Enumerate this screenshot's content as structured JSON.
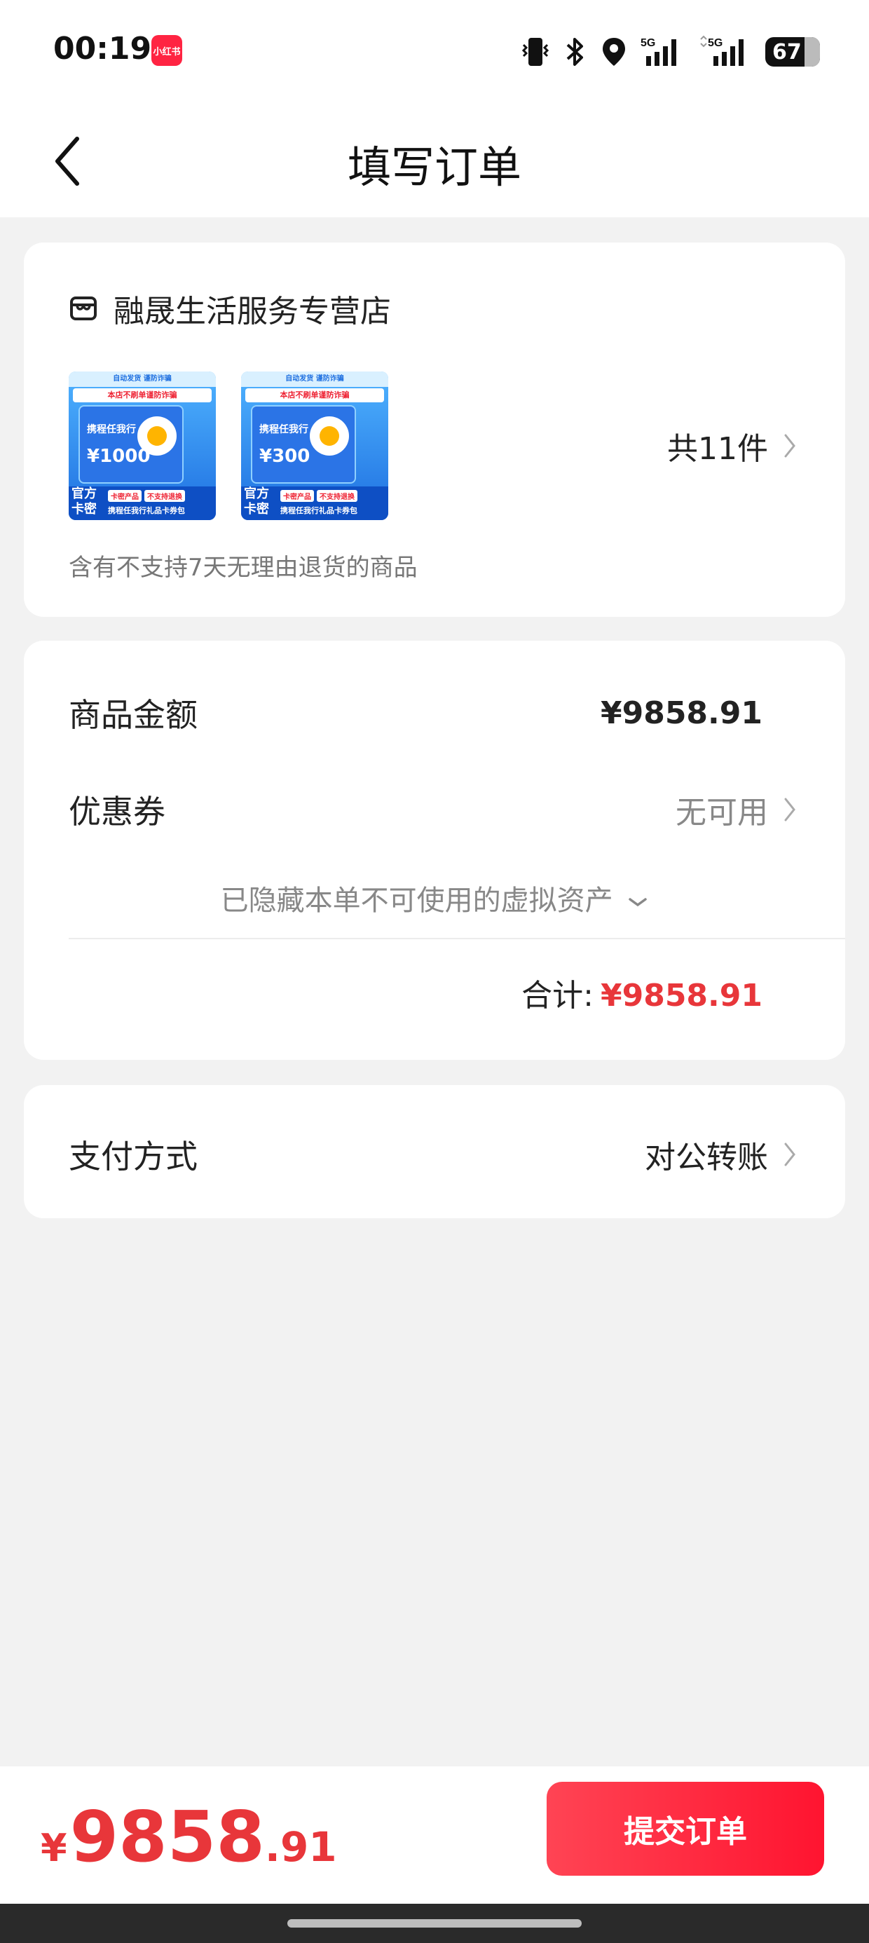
{
  "status_bar": {
    "time": "00:19",
    "app_badge": "小红书",
    "network_1": "5G",
    "network_2": "5G",
    "battery": "67"
  },
  "nav": {
    "title": "填写订单"
  },
  "store": {
    "name": "融晟生活服务专营店",
    "item_count": "共11件",
    "note": "含有不支持7天无理由退货的商品",
    "products": [
      {
        "banner": "自动发货 谨防诈骗",
        "warning": "本店不刷单谨防诈骗",
        "brand": "携程任我行",
        "amount": "¥1000",
        "official": "官方卡密",
        "tag1": "卡密产品",
        "tag2": "不支持退换",
        "pack": "携程任我行礼品卡券包"
      },
      {
        "banner": "自动发货 谨防诈骗",
        "warning": "本店不刷单谨防诈骗",
        "brand": "携程任我行",
        "amount": "¥300",
        "official": "官方卡密",
        "tag1": "卡密产品",
        "tag2": "不支持退换",
        "pack": "携程任我行礼品卡券包"
      }
    ]
  },
  "summary": {
    "goods_label": "商品金额",
    "goods_value": "¥9858.91",
    "coupon_label": "优惠券",
    "coupon_value": "无可用",
    "hidden_assets": "已隐藏本单不可使用的虚拟资产",
    "total_label": "合计:",
    "total_value": "¥9858.91"
  },
  "payment": {
    "label": "支付方式",
    "value": "对公转账"
  },
  "footer": {
    "currency": "¥",
    "price_int": "9858",
    "price_dec": ".91",
    "submit_label": "提交订单"
  },
  "colors": {
    "accent": "#e8363a",
    "button": "#ff1430",
    "background": "#f2f2f2"
  }
}
